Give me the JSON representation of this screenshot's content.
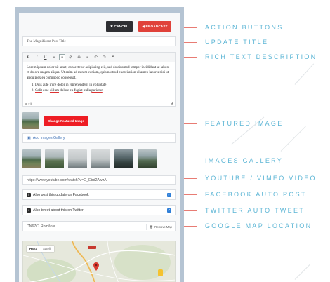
{
  "header": {
    "cancel_label": "✖ CANCEL",
    "broadcast_label": "◀ BROADCAST"
  },
  "update_title": {
    "value": "The Magnificent Post Title"
  },
  "editor": {
    "toolbar": [
      "B",
      "I",
      "U",
      "≡",
      "≡",
      "⊘",
      "⊕",
      "≡",
      "↶",
      "↷",
      "❝"
    ],
    "paragraph": "Lorem ipsum dolor sit amet, consectetur adipiscing elit, sed do eiusmod tempor incididunt ut labore et dolore magna aliqua. Ut enim ad minim veniam, quis nostrud exercitation ullamco laboris nisi ut aliquip ex ea commodo consequat.",
    "list_item_1": "Duis aute irure dolor in reprehenderit in voluptate",
    "list_item_2_a": "Celit",
    "list_item_2_b": " esse ",
    "list_item_2_c": "cillum",
    "list_item_2_d": " dolore eu ",
    "list_item_2_e": "fugiat",
    "list_item_2_f": " nulla ",
    "list_item_2_g": "pariatur",
    "list_item_2_h": ".",
    "path": "ol » li"
  },
  "featured": {
    "button_label": "Change Featured Image"
  },
  "gallery": {
    "link_label": "Add Images Gallery",
    "images": [
      "mountain",
      "mountain-2",
      "fog",
      "dark",
      "valley",
      "lake"
    ]
  },
  "video": {
    "value": "https://www.youtube.com/watch?v=G_Etrd2AwzA"
  },
  "facebook": {
    "label": "Also post this update on Facebook",
    "checked": true
  },
  "twitter": {
    "label": "Also tweet about this on Twitter",
    "checked": true
  },
  "map": {
    "location": "DN67C, România",
    "remove_label": "Remove Map",
    "tab_map": "Harta",
    "tab_satellite": "Satelit"
  },
  "labels": {
    "action_buttons": "ACTION BUTTONS",
    "update_title": "UPDATE TITLE",
    "rich_text": "RICH TEXT DESCRIPTION",
    "featured_image": "FEATURED IMAGE",
    "images_gallery": "IMAGES GALLERY",
    "video": "YOUTUBE / VIMEO VIDEO",
    "facebook": "FACEBOOK AUTO POST",
    "twitter": "TWITTER AUTO TWEET",
    "map": "GOOGLE MAP LOCATION"
  },
  "colors": {
    "accent_red": "#e0423a",
    "label_blue": "#5bb5d5",
    "frame": "#b5c4d3"
  }
}
